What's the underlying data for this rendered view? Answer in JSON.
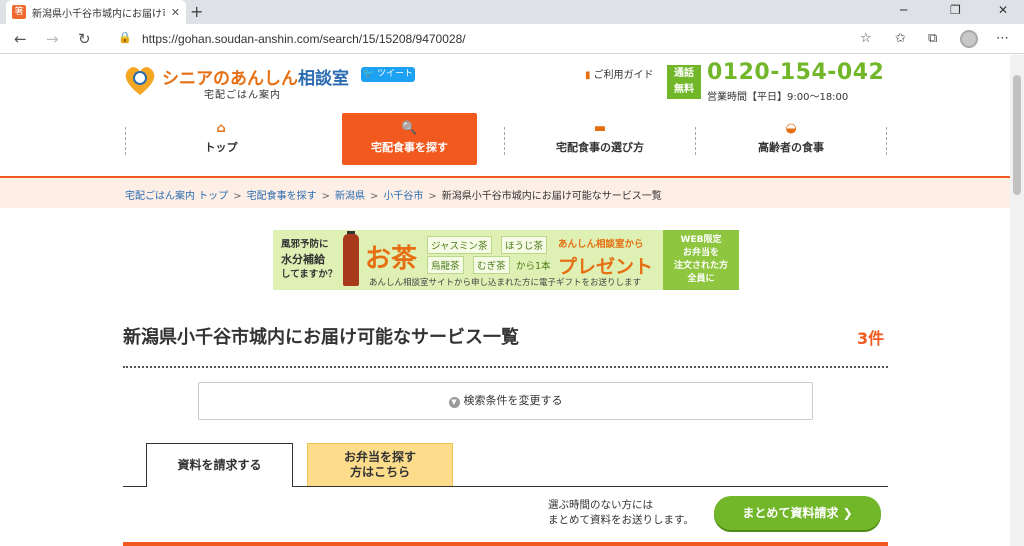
{
  "browser": {
    "tab_title": "新潟県小千谷市城内にお届け可能な",
    "tab_favicon": "箸",
    "url": "https://gohan.soudan-anshin.com/search/15/15208/9470028/"
  },
  "header": {
    "logo_title_a": "シニアの",
    "logo_title_b": "あんしん",
    "logo_title_c": "相談室",
    "logo_subtitle": "宅配ごはん案内",
    "tweet_label": "ツイート",
    "guide_label": "ご利用ガイド",
    "free_badge_l1": "通話",
    "free_badge_l2": "無料",
    "phone": "0120-154-042",
    "hours": "営業時間【平日】9:00〜18:00"
  },
  "nav": {
    "items": [
      {
        "label": "トップ"
      },
      {
        "label": "宅配食事を探す"
      },
      {
        "label": "宅配食事の選び方"
      },
      {
        "label": "高齢者の食事"
      }
    ]
  },
  "breadcrumb": {
    "items": [
      "宅配ごはん案内 トップ",
      "宅配食事を探す",
      "新潟県",
      "小千谷市"
    ],
    "current": "新潟県小千谷市城内にお届け可能なサービス一覧"
  },
  "banner": {
    "left_l1": "風邪予防に",
    "left_l2": "水分補給",
    "left_l3": "してますか？",
    "ocha": "お茶",
    "teas": [
      "ジャスミン茶",
      "ほうじ茶",
      "烏龍茶",
      "むぎ茶"
    ],
    "kara": "から1本",
    "from": "あんしん相談室から",
    "present": "プレゼント",
    "foot": "あんしん相談室サイトから申し込まれた方に電子ギフトをお送りします",
    "web_l1": "WEB限定",
    "web_l2": "お弁当を",
    "web_l3": "注文された方",
    "web_l4": "全員に"
  },
  "main": {
    "heading": "新潟県小千谷市城内にお届け可能なサービス一覧",
    "count": "3件",
    "search_condition": "検索条件を変更する",
    "tab_request": "資料を請求する",
    "tab_bento_l1": "お弁当を探す",
    "tab_bento_l2": "方はこちら",
    "note_l1": "選ぶ時間のない方には",
    "note_l2": "まとめて資料をお送りします。",
    "request_button": "まとめて資料請求"
  },
  "colors": {
    "accent_orange": "#f2591e",
    "green": "#72b72a",
    "link_blue": "#2b6cb0"
  }
}
